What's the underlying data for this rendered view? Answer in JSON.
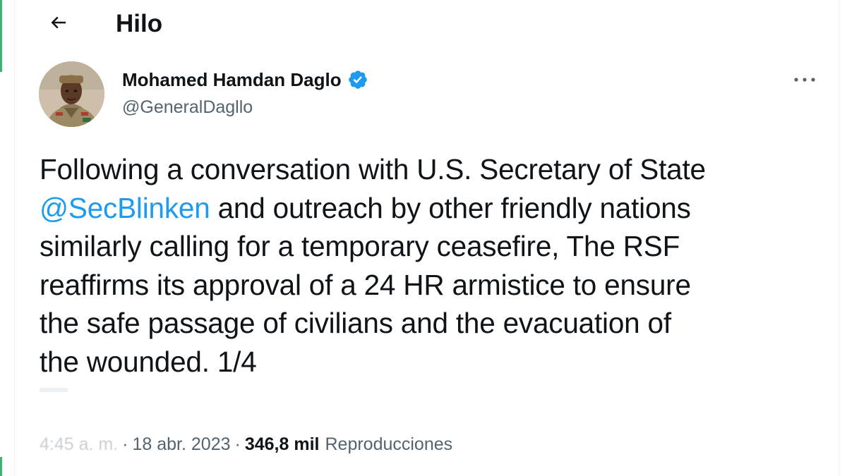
{
  "header": {
    "title": "Hilo",
    "back_icon": "arrow-left-icon"
  },
  "author": {
    "name": "Mohamed Hamdan Daglo",
    "handle": "@GeneralDagllo",
    "verified_icon": "verified-badge-icon",
    "verified_color": "#1d9bf0",
    "more_icon": "more-horizontal-icon"
  },
  "tweet": {
    "lines": [
      {
        "segments": [
          {
            "text": "Following a conversation with U.S. Secretary of State",
            "type": "text"
          }
        ]
      },
      {
        "segments": [
          {
            "text": "@SecBlinken",
            "type": "mention"
          },
          {
            "text": " and outreach by other friendly nations",
            "type": "text"
          }
        ]
      },
      {
        "segments": [
          {
            "text": "similarly calling for a temporary ceasefire, The RSF",
            "type": "text"
          }
        ]
      },
      {
        "segments": [
          {
            "text": "reaffirms its approval of a 24 HR armistice to ensure",
            "type": "text"
          }
        ]
      },
      {
        "segments": [
          {
            "text": "the safe passage of civilians and the evacuation of",
            "type": "text"
          }
        ]
      },
      {
        "segments": [
          {
            "text": "the wounded. 1/4",
            "type": "text"
          }
        ]
      }
    ],
    "mention_color": "#1d9bf0"
  },
  "meta": {
    "time": "4:45 a. m.",
    "date": "18 abr. 2023",
    "separator": "·",
    "views_count": "346,8 mil",
    "views_label": "Reproducciones"
  },
  "colors": {
    "text_primary": "#0f1419",
    "text_secondary": "#536471",
    "accent": "#1d9bf0"
  }
}
